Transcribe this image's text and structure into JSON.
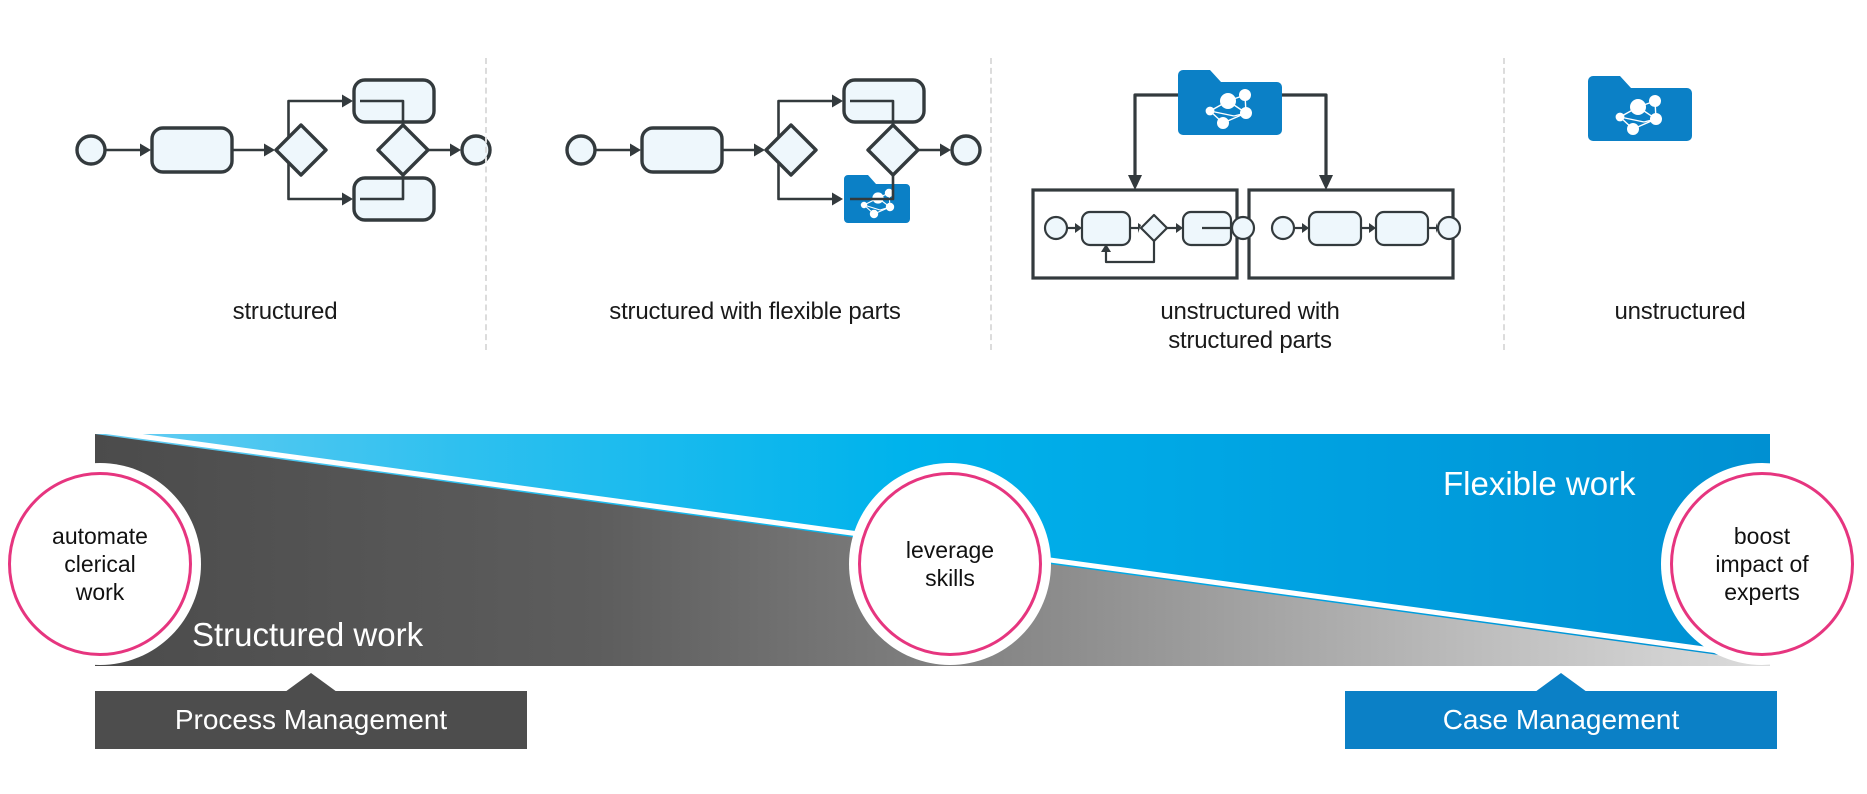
{
  "colors": {
    "bpmn_fill": "#eef7fc",
    "bpmn_stroke": "#333a3d",
    "folder_blue": "#0b80c6",
    "accent_pink": "#e6357f",
    "dark_gray": "#4d4d4d",
    "mid_gray": "#8a8a8a",
    "light_gray": "#cfcfcf",
    "cyan_light": "#5bc8f0",
    "blue_deep": "#0092d6",
    "case_blue": "#0b80c6",
    "divider_gray": "#dcdcdc",
    "label_text": "#1a1a1a",
    "white": "#ffffff"
  },
  "panels": [
    {
      "id": "structured",
      "label": "structured",
      "icon": "bpmn-structured-diagram"
    },
    {
      "id": "structured-flexible",
      "label": "structured with flexible parts",
      "icon": "bpmn-structured-with-case-folder-diagram"
    },
    {
      "id": "unstructured-structured",
      "label": "unstructured with\nstructured parts",
      "label_line1": "unstructured with",
      "label_line2": "structured parts",
      "icon": "case-folder-with-subprocess-diagram"
    },
    {
      "id": "unstructured",
      "label": "unstructured",
      "icon": "case-folder-icon"
    }
  ],
  "band": {
    "left_label": "Structured work",
    "right_label": "Flexible work"
  },
  "bubbles": [
    {
      "id": "automate",
      "line1": "automate",
      "line2": "clerical",
      "line3": "work"
    },
    {
      "id": "leverage",
      "line1": "leverage",
      "line2": "skills",
      "line3": ""
    },
    {
      "id": "boost",
      "line1": "boost",
      "line2": "impact of",
      "line3": "experts"
    }
  ],
  "callouts": [
    {
      "id": "process-management",
      "label": "Process Management",
      "color": "#4d4d4d"
    },
    {
      "id": "case-management",
      "label": "Case Management",
      "color": "#0b80c6"
    }
  ]
}
